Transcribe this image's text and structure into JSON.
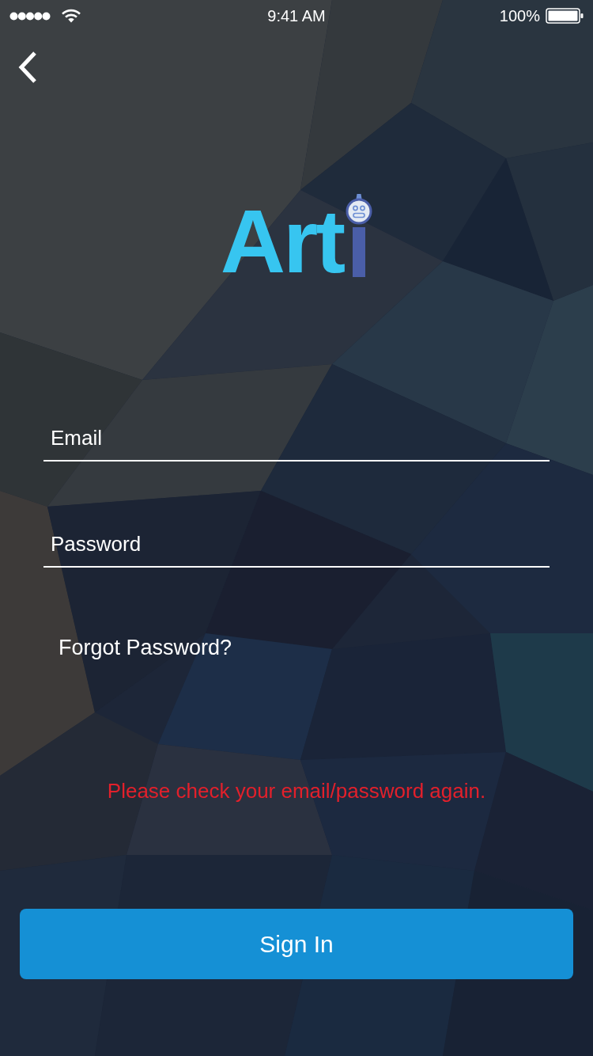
{
  "status_bar": {
    "time": "9:41 AM",
    "battery": "100%"
  },
  "logo": {
    "text": "Art"
  },
  "form": {
    "fields": [
      {
        "placeholder": "Email"
      },
      {
        "placeholder": "Password"
      }
    ],
    "forgot_link": "Forgot Password?",
    "error": "Please check your email/password again.",
    "submit": "Sign In"
  }
}
